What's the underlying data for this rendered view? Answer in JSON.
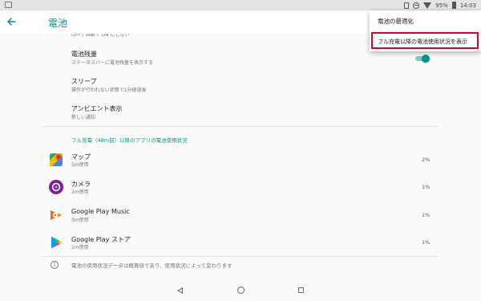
{
  "status_bar": {
    "battery_percent": "95%",
    "time": "14:03"
  },
  "toolbar": {
    "title": "電池"
  },
  "settings": {
    "truncated_text": "OFF / 自動で ON にしない",
    "battery_level": {
      "title": "電池残量",
      "subtitle": "ステータスバーに電池残量を表示する",
      "enabled": true
    },
    "sleep": {
      "title": "スリープ",
      "subtitle": "操作が行われない状態で1分経過後"
    },
    "ambient": {
      "title": "アンビエント表示",
      "subtitle": "新しい通知"
    }
  },
  "usage_section": {
    "header": "フル充電（48m前）以降のアプリの電池使用状況",
    "apps": [
      {
        "name": "マップ",
        "usage": "5m使用",
        "percent": "2%",
        "icon": "maps-icon"
      },
      {
        "name": "カメラ",
        "usage": "2m使用",
        "percent": "1%",
        "icon": "camera-icon"
      },
      {
        "name": "Google Play Music",
        "usage": "3m使用",
        "percent": "1%",
        "icon": "play-music-icon"
      },
      {
        "name": "Google Play ストア",
        "usage": "1m使用",
        "percent": "1%",
        "icon": "play-store-icon"
      }
    ],
    "footer": "電池の使用状況データは概算値であり、使用状況によって変わります"
  },
  "overflow_menu": {
    "items": [
      "電池の最適化",
      "フル充電以降の電池使用状況を表示"
    ],
    "highlight_color": "#e0001b"
  },
  "colors": {
    "accent": "#009688"
  }
}
